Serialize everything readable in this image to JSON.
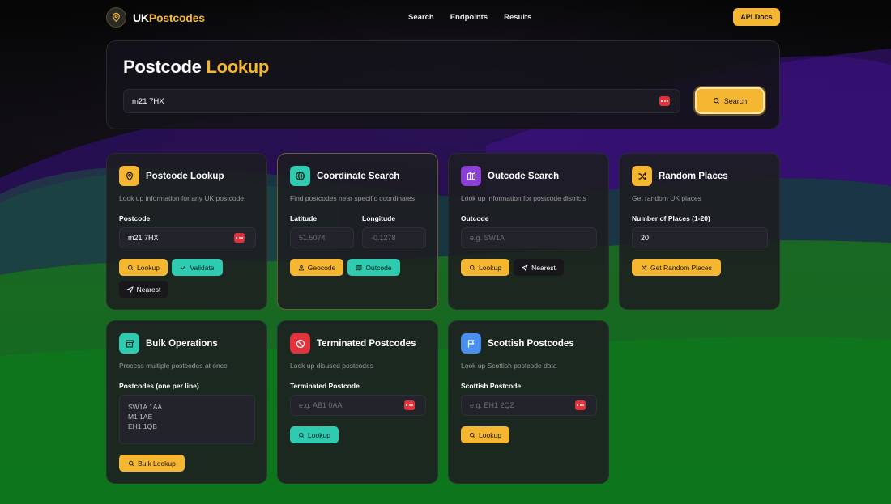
{
  "brand": {
    "name_a": "UK",
    "name_b": "Postcodes"
  },
  "nav": {
    "links": [
      "Search",
      "Endpoints",
      "Results"
    ],
    "api_docs": "API Docs"
  },
  "hero": {
    "title_a": "Postcode",
    "title_b": "Lookup",
    "query_value": "m21 7HX",
    "search_label": "Search"
  },
  "cards": {
    "postcode_lookup": {
      "title": "Postcode Lookup",
      "desc": "Look up information for any UK postcode.",
      "field_label": "Postcode",
      "value": "m21 7HX",
      "buttons": [
        "Lookup",
        "Validate",
        "Nearest"
      ]
    },
    "coordinate_search": {
      "title": "Coordinate Search",
      "desc": "Find postcodes near specific coordinates",
      "lat_label": "Latitude",
      "lon_label": "Longitude",
      "lat_placeholder": "51.5074",
      "lon_placeholder": "-0.1278",
      "buttons": [
        "Geocode",
        "Outcode"
      ]
    },
    "outcode_search": {
      "title": "Outcode Search",
      "desc": "Look up information for postcode districts",
      "field_label": "Outcode",
      "placeholder": "e.g. SW1A",
      "buttons": [
        "Lookup",
        "Nearest"
      ]
    },
    "random_places": {
      "title": "Random Places",
      "desc": "Get random UK places",
      "field_label": "Number of Places (1-20)",
      "value": "20",
      "button": "Get Random Places"
    },
    "bulk_operations": {
      "title": "Bulk Operations",
      "desc": "Process multiple postcodes at once",
      "field_label": "Postcodes (one per line)",
      "placeholder": "SW1A 1AA\nM1 1AE\nEH1 1QB",
      "button": "Bulk Lookup"
    },
    "terminated_postcodes": {
      "title": "Terminated Postcodes",
      "desc": "Look up disused postcodes",
      "field_label": "Terminated Postcode",
      "placeholder": "e.g. AB1 0AA",
      "button": "Lookup"
    },
    "scottish_postcodes": {
      "title": "Scottish Postcodes",
      "desc": "Look up Scottish postcode data",
      "field_label": "Scottish Postcode",
      "placeholder": "e.g. EH1 2QZ",
      "button": "Lookup"
    }
  },
  "colors": {
    "accent": "#f5b731",
    "teal": "#2ecbb0",
    "purple": "#8b3fd6",
    "red": "#e0333b",
    "blue": "#4a8ef0"
  }
}
